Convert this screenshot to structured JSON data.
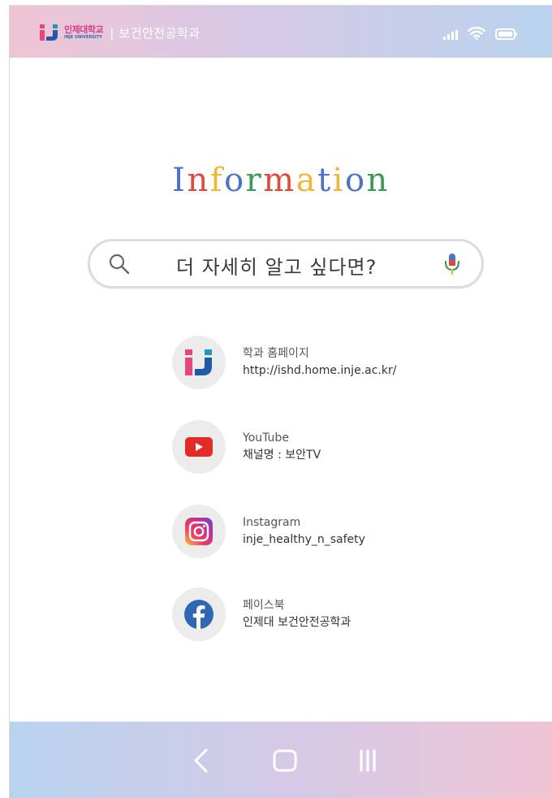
{
  "status_bar": {
    "logo_kr": "인제대학교",
    "logo_en": "INJE UNIVERSITY",
    "separator": "|",
    "department": "보건안전공학과",
    "icons": [
      "signal-icon",
      "wifi-icon",
      "battery-icon"
    ]
  },
  "title": {
    "letters": [
      "I",
      "n",
      "f",
      "o",
      "r",
      "m",
      "a",
      "t",
      "i",
      "o",
      "n"
    ],
    "colors": {
      "blue": "#4c73c7",
      "red": "#de4a3c",
      "yellow": "#f0b63a",
      "green": "#3a9a58"
    }
  },
  "search": {
    "placeholder": "더 자세히 알고 싶다면?",
    "icons": [
      "search-icon",
      "mic-icon"
    ]
  },
  "links": [
    {
      "icon": "inje-logo-icon",
      "title": "학과 홈페이지",
      "subtitle": "http://ishd.home.inje.ac.kr/"
    },
    {
      "icon": "youtube-icon",
      "title": "YouTube",
      "subtitle": "채널명 : 보안TV"
    },
    {
      "icon": "instagram-icon",
      "title": "Instagram",
      "subtitle": "inje_healthy_n_safety"
    },
    {
      "icon": "facebook-icon",
      "title": "페이스북",
      "subtitle": "인제대 보건안전공학과"
    }
  ],
  "nav_bar": {
    "buttons": [
      "back-icon",
      "home-icon",
      "recent-apps-icon"
    ]
  },
  "colors": {
    "status_gradient": [
      "#efc5d4",
      "#d6c9e6",
      "#b9d3ee"
    ],
    "youtube_red": "#e32b27",
    "facebook_blue": "#2f67b2"
  }
}
